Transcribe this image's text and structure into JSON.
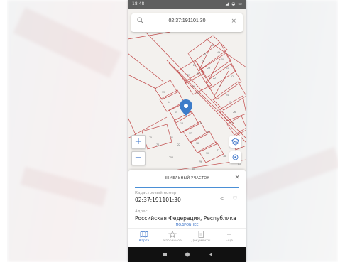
{
  "status_bar": {
    "time": "18:48",
    "icons": "◢ ◒ ▭"
  },
  "search": {
    "value": "02:37:191101:30",
    "search_icon": "search-icon",
    "clear_icon": "close-icon"
  },
  "map": {
    "parcel_labels": [
      "30",
      "49",
      "50",
      "51",
      "52",
      "6",
      "28",
      "29",
      "27",
      "5",
      "21",
      "22",
      "23",
      "24",
      "19",
      "20",
      "25",
      "26",
      "13",
      "14",
      "15",
      "16",
      "17",
      "18",
      "10",
      "11",
      "12",
      "8",
      "9",
      "7",
      "75",
      "76",
      "77",
      "78",
      "93",
      "94",
      "79",
      "80",
      "81",
      "82",
      "83",
      "21",
      "29",
      "22",
      "256"
    ],
    "line_color": "#c04848",
    "pin_color": "#3d7cc9"
  },
  "zoom": {
    "plus": "+",
    "minus": "−"
  },
  "sheet": {
    "title": "Земельный участок",
    "close": "×",
    "cadastral_label": "Кадастровый номер",
    "cadastral_value": "02:37:191101:30",
    "address_label": "Адрес",
    "address_value": "Российская Федерация, Республика",
    "more_link": "ПОДРОБНЕЕ"
  },
  "bottom_nav": {
    "items": [
      {
        "label": "Карта",
        "icon": "map-icon",
        "active": true
      },
      {
        "label": "Избранное",
        "icon": "star-icon",
        "active": false
      },
      {
        "label": "Документы",
        "icon": "document-icon",
        "active": false
      },
      {
        "label": "Ещё",
        "icon": "more-icon",
        "active": false
      }
    ]
  },
  "colors": {
    "accent": "#3a73c8",
    "progress": "#4a8fd6"
  }
}
